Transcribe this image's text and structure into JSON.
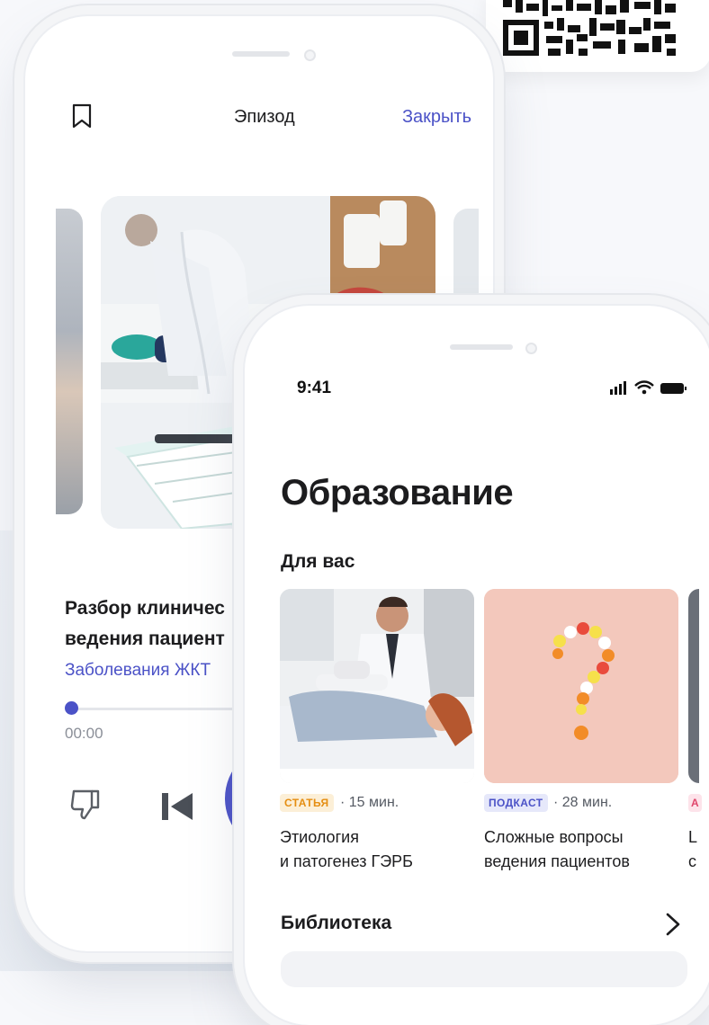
{
  "episode_screen": {
    "header_title": "Эпизод",
    "close_label": "Закрыть",
    "title_line1": "Разбор клиничес",
    "title_line2": "ведения пациент",
    "category": "Заболевания ЖКТ",
    "elapsed_time": "00:00",
    "progress": 0,
    "accent_color": "#4b52c7"
  },
  "education_screen": {
    "status_time": "9:41",
    "title": "Образование",
    "section_for_you": "Для вас",
    "cards": [
      {
        "tag": "СТАТЬЯ",
        "tag_color": "#f5a623",
        "tag_bg": "#fdf0d8",
        "duration": "· 15 мин.",
        "title_line1": "Этиология",
        "title_line2": "и патогенез ГЭРБ"
      },
      {
        "tag": "ПОДКАСТ",
        "tag_color": "#4b52c7",
        "tag_bg": "#e6e8fa",
        "duration": "· 28 мин.",
        "title_line1": "Сложные вопросы",
        "title_line2": "ведения пациентов"
      },
      {
        "tag": "A",
        "tag_color": "#e0456b",
        "tag_bg": "#fde3ea",
        "title_line1": "L",
        "title_line2": "c"
      }
    ],
    "section_library": "Библиотека"
  },
  "icons": [
    "bookmark-icon",
    "dislike-icon",
    "skip-back-icon",
    "play-icon",
    "signal-icon",
    "wifi-icon",
    "battery-icon",
    "chevron-right-icon",
    "qr-code"
  ]
}
